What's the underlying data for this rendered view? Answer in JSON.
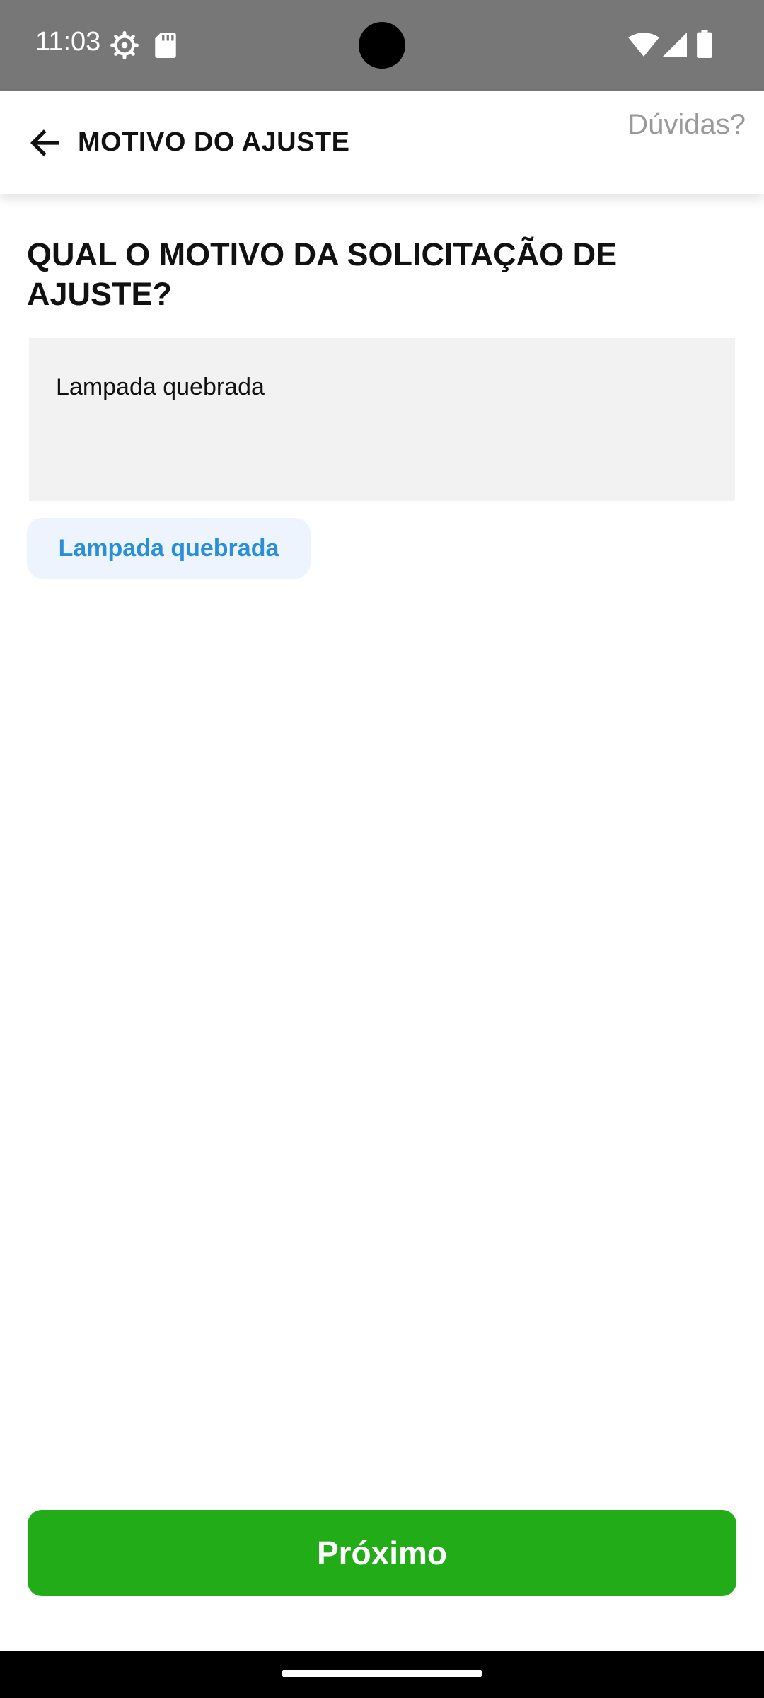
{
  "status_bar": {
    "time": "11:03",
    "icons": [
      "settings-gear-icon",
      "sd-card-icon",
      "wifi-icon",
      "cell-signal-icon",
      "battery-icon"
    ]
  },
  "header": {
    "title": "MOTIVO DO AJUSTE",
    "help_label": "Dúvidas?",
    "back_icon": "arrow-left-icon"
  },
  "form": {
    "question": "QUAL O MOTIVO DA SOLICITAÇÃO DE AJUSTE?",
    "reason_value": "Lampada quebrada",
    "suggestion_label": "Lampada quebrada"
  },
  "footer": {
    "next_label": "Próximo"
  },
  "colors": {
    "status_bar": "#777777",
    "accent_green": "#22ad18",
    "chip_text": "#2a8fd8",
    "chip_background": "#edf4fd",
    "input_background": "#f2f2f2",
    "help_text": "#9a9a9a"
  }
}
